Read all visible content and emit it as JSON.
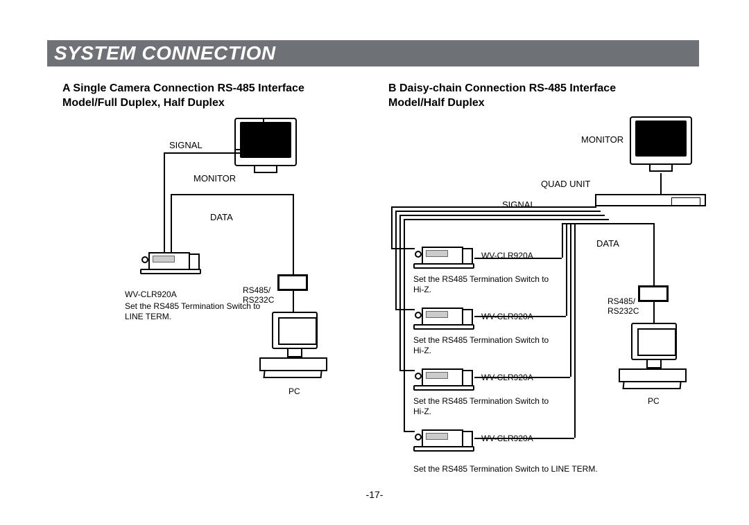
{
  "title": "SYSTEM CONNECTION",
  "page_number": "-17-",
  "sectionA": {
    "heading_line1": "A  Single Camera Connection RS-485 Interface",
    "heading_line2": "Model/Full Duplex, Half Duplex",
    "labels": {
      "signal": "SIGNAL",
      "monitor": "MONITOR",
      "data": "DATA",
      "camera_model": "WV-CLR920A",
      "camera_note": "Set the RS485 Termination Switch to LINE TERM.",
      "adapter": "RS485/\nRS232C",
      "pc": "PC"
    }
  },
  "sectionB": {
    "heading_line1": "B  Daisy-chain Connection RS-485 Interface",
    "heading_line2": "Model/Half Duplex",
    "labels": {
      "monitor": "MONITOR",
      "quad_unit": "QUAD UNIT",
      "signal": "SIGNAL",
      "data": "DATA",
      "adapter": "RS485/\nRS232C",
      "pc": "PC",
      "last_note": "Set the RS485 Termination Switch to LINE TERM."
    },
    "cameras": [
      {
        "model": "WV-CLR920A",
        "note": "Set the RS485 Termination Switch to Hi-Z."
      },
      {
        "model": "WV-CLR920A",
        "note": "Set the RS485 Termination Switch to Hi-Z."
      },
      {
        "model": "WV-CLR920A",
        "note": "Set the RS485 Termination Switch to Hi-Z."
      },
      {
        "model": "WV-CLR920A",
        "note": ""
      }
    ]
  }
}
